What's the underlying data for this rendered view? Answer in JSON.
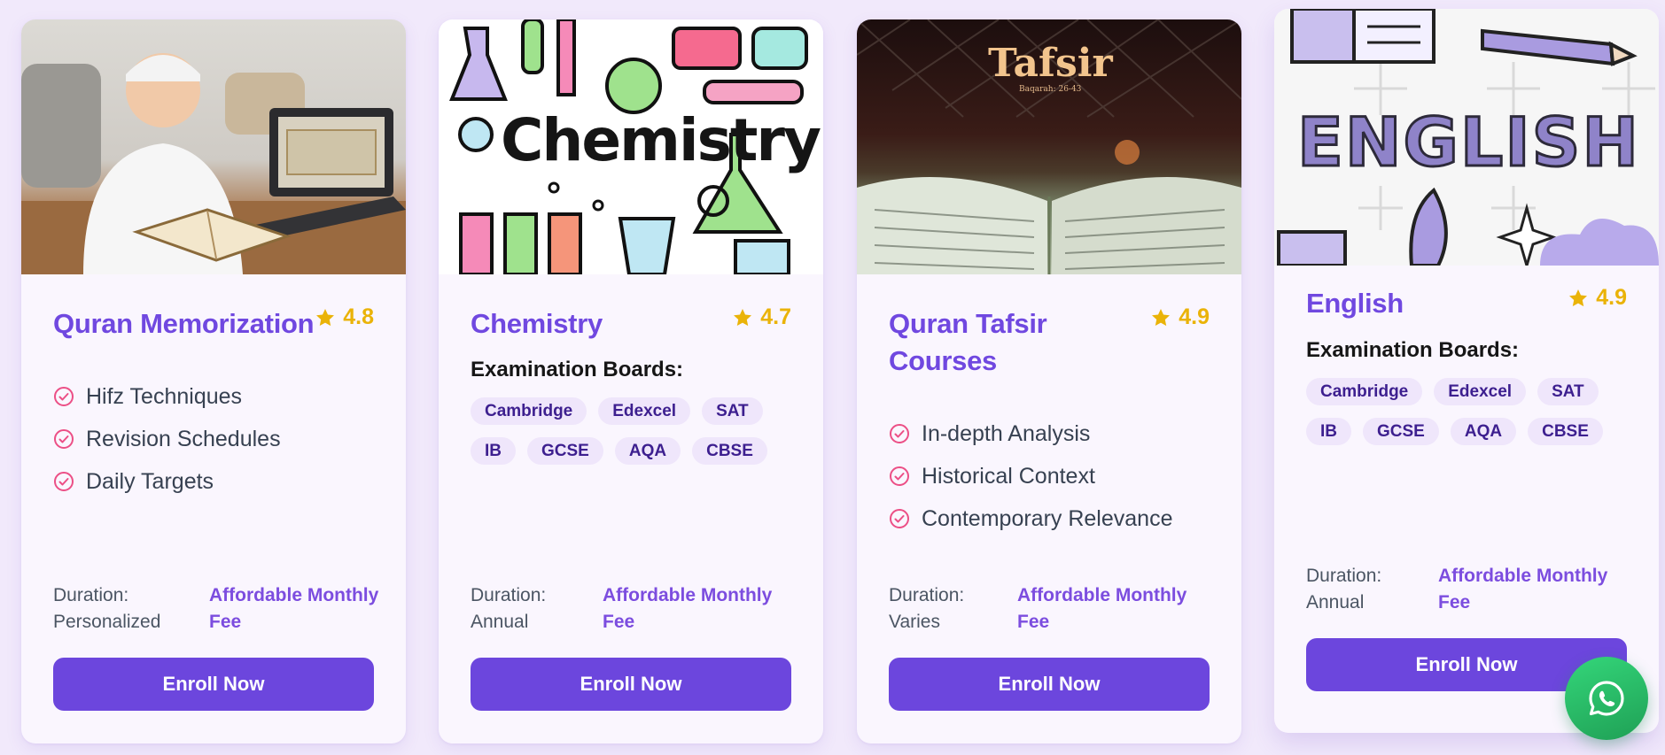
{
  "cards": [
    {
      "title": "Quran Memorization",
      "rating": "4.8",
      "features": [
        "Hifz Techniques",
        "Revision Schedules",
        "Daily Targets"
      ],
      "duration_label": "Duration:",
      "duration_value": "Personalized",
      "fee": "Affordable Monthly Fee",
      "cta": "Enroll Now",
      "image": "boy-reading-quran-with-laptop"
    },
    {
      "title": "Chemistry",
      "rating": "4.7",
      "boards_label": "Examination Boards:",
      "boards": [
        "Cambridge",
        "Edexcel",
        "SAT",
        "IB",
        "GCSE",
        "AQA",
        "CBSE"
      ],
      "duration_label": "Duration:",
      "duration_value": "Annual",
      "fee": "Affordable Monthly Fee",
      "cta": "Enroll Now",
      "image_text": "Chemistry"
    },
    {
      "title": "Quran Tafsir Courses",
      "rating": "4.9",
      "features": [
        "In-depth Analysis",
        "Historical Context",
        "Contemporary Relevance"
      ],
      "duration_label": "Duration:",
      "duration_value": "Varies",
      "fee": "Affordable Monthly Fee",
      "cta": "Enroll Now",
      "image_text": "Tafsir",
      "image_subtext": "Baqarah: 26-43"
    },
    {
      "title": "English",
      "rating": "4.9",
      "boards_label": "Examination Boards:",
      "boards": [
        "Cambridge",
        "Edexcel",
        "SAT",
        "IB",
        "GCSE",
        "AQA",
        "CBSE"
      ],
      "duration_label": "Duration:",
      "duration_value": "Annual",
      "fee": "Affordable Monthly Fee",
      "cta": "Enroll Now",
      "image_text": "ENGLISH"
    }
  ],
  "icons": {
    "rating": "star-icon",
    "feature": "check-circle-icon",
    "floating": "whatsapp-icon"
  },
  "colors": {
    "accent": "#6c46dd",
    "title": "#7048e0",
    "star": "#eab308",
    "check": "#ec4f86",
    "whatsapp": "#25c16a"
  }
}
